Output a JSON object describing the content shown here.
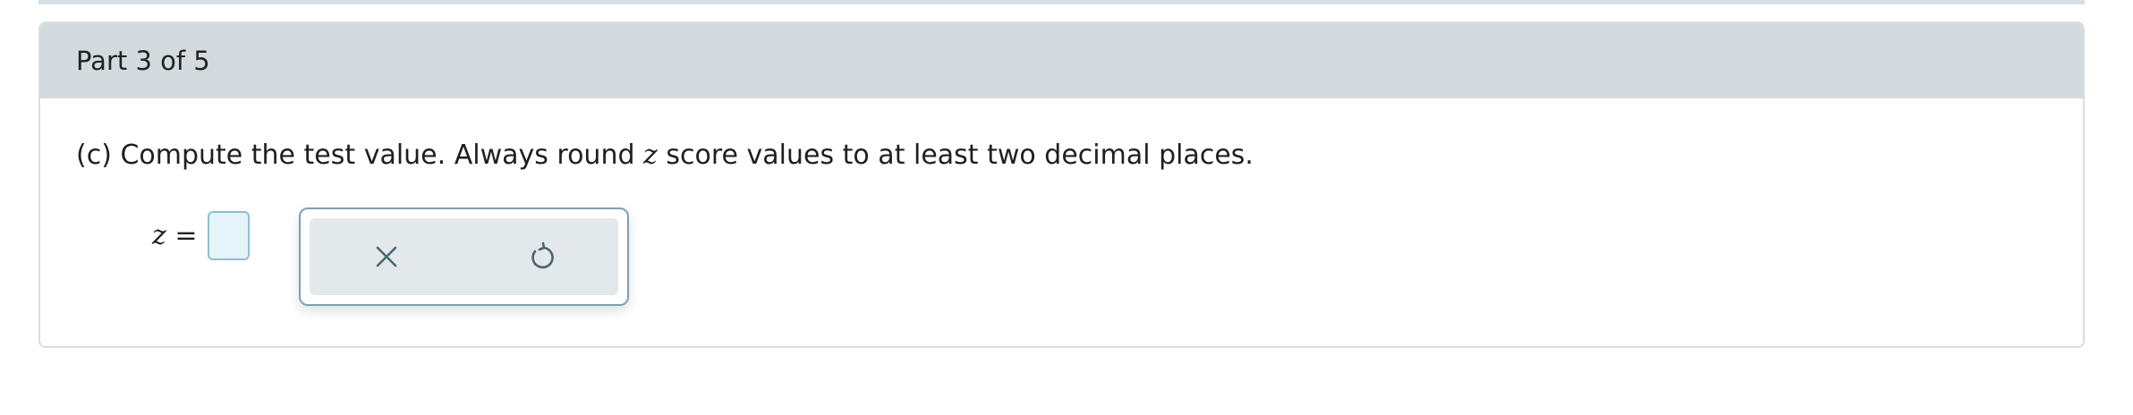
{
  "part": {
    "label": "Part 3 of 5"
  },
  "question": {
    "prefix": "(c) Compute the test value. Always round ",
    "variable": "z",
    "suffix": " score values to at least two decimal places."
  },
  "answer": {
    "label": "z =",
    "value": ""
  },
  "tools": {
    "clear_icon": "close-icon",
    "reset_icon": "undo-icon",
    "icon_color": "#4a6572"
  },
  "colors": {
    "header_bg": "#d3dbdf",
    "input_border": "#8bbfd3",
    "input_bg": "#e5f4f8",
    "tool_panel_bg": "#e3e8ea"
  }
}
